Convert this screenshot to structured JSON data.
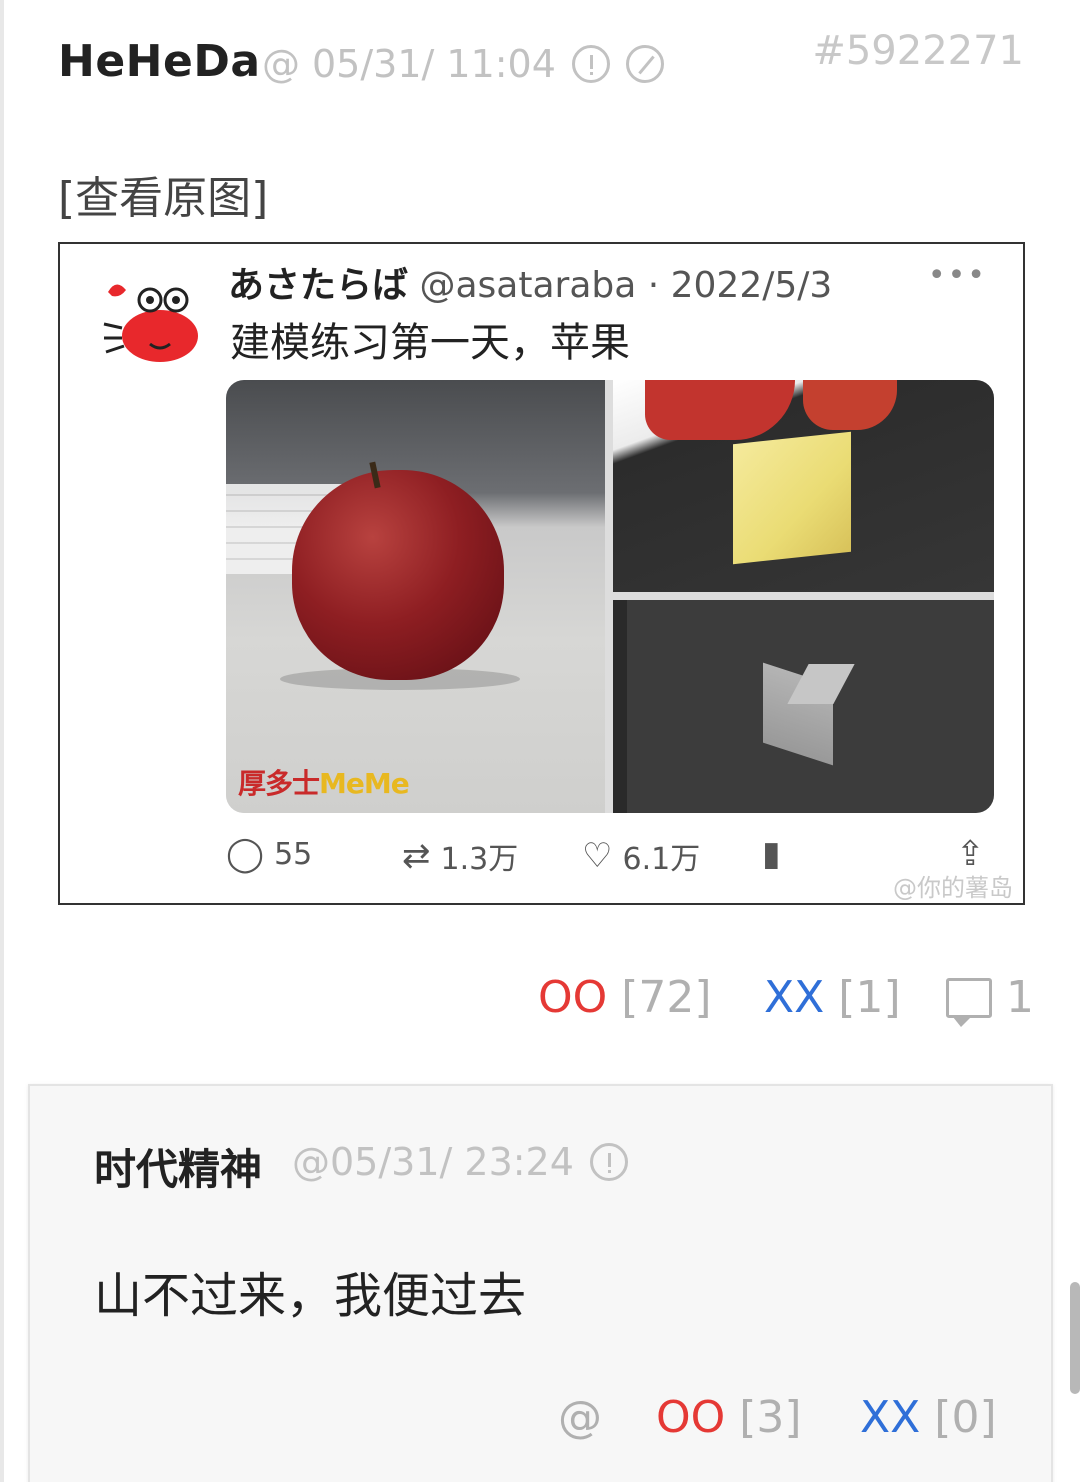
{
  "post": {
    "author": "HeHeDa",
    "at": "@",
    "timestamp": "05/31/ 11:04",
    "post_id": "#5922271",
    "view_original": "[查看原图]",
    "report_icon": "exclamation-circle-icon",
    "block_icon": "slash-circle-icon",
    "embedded_tweet": {
      "display_name": "あさたらば",
      "handle_date": "@asataraba · 2022/5/3",
      "more": "•••",
      "text": "建模练习第一天，苹果",
      "watermark_red": "厚多士",
      "watermark_yellow": "MeMe",
      "actions": {
        "replies": "55",
        "retweets": "1.3万",
        "likes": "6.1万"
      },
      "source_mark": "@你的薯岛"
    },
    "votes": {
      "oo_label": "OO",
      "oo_count": "[72]",
      "xx_label": "XX",
      "xx_count": "[1]",
      "comment_count": "1"
    }
  },
  "reply": {
    "author": "时代精神",
    "timestamp": "@05/31/ 23:24",
    "text": "山不过来，我便过去",
    "at_label": "@",
    "oo_label": "OO",
    "oo_count": "[3]",
    "xx_label": "XX",
    "xx_count": "[0]"
  },
  "colors": {
    "oo": "#e53935",
    "xx": "#2f6fd8",
    "muted": "#c2c2c2"
  }
}
